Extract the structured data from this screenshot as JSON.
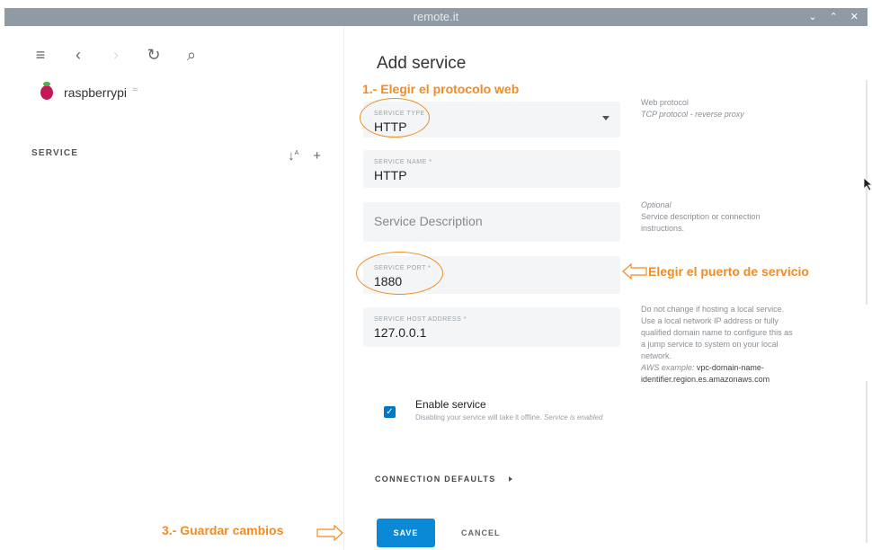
{
  "window": {
    "title": "remote.it",
    "controls": [
      "⌄",
      "⌃",
      "✕"
    ]
  },
  "left": {
    "device_name": "raspberrypi",
    "service_header": "SERVICE",
    "sort_icon_text": "↓",
    "sort_sub": "A Z"
  },
  "form": {
    "title": "Add service",
    "service_type": {
      "label": "SERVICE TYPE",
      "value": "HTTP"
    },
    "service_type_help": {
      "line1": "Web protocol",
      "line2": "TCP protocol - reverse proxy"
    },
    "service_name": {
      "label": "SERVICE NAME *",
      "value": "HTTP"
    },
    "description": {
      "placeholder": "Service Description"
    },
    "description_help": {
      "line1": "Optional",
      "line2": "Service description or connection",
      "line3": "instructions."
    },
    "service_port": {
      "label": "SERVICE PORT *",
      "value": "1880"
    },
    "host_address": {
      "label": "SERVICE HOST ADDRESS *",
      "value": "127.0.0.1"
    },
    "host_help": {
      "line1": "Do not change if hosting a local service.",
      "line2": "Use a local network IP address or fully",
      "line3": "qualified domain name to configure this as",
      "line4": "a jump service to system on your local",
      "line5": "network.",
      "example_label": "AWS example:",
      "example_value_1": "vpc-domain-name-",
      "example_value_2": "identifier.region.es.amazonaws.com"
    },
    "enable": {
      "title": "Enable service",
      "sub_plain": "Disabling your service will take it offline.",
      "sub_italic": "Service is enabled"
    },
    "connection_defaults": "CONNECTION DEFAULTS",
    "save": "SAVE",
    "cancel": "CANCEL"
  },
  "annotations": {
    "step1": "1.- Elegir el protocolo web",
    "step2": "Elegir el puerto de servicio",
    "step3": "3.- Guardar cambios",
    "color": "#f08c24"
  },
  "colors": {
    "accent": "#0a8ad6",
    "titlebar": "#8f9aa3"
  }
}
